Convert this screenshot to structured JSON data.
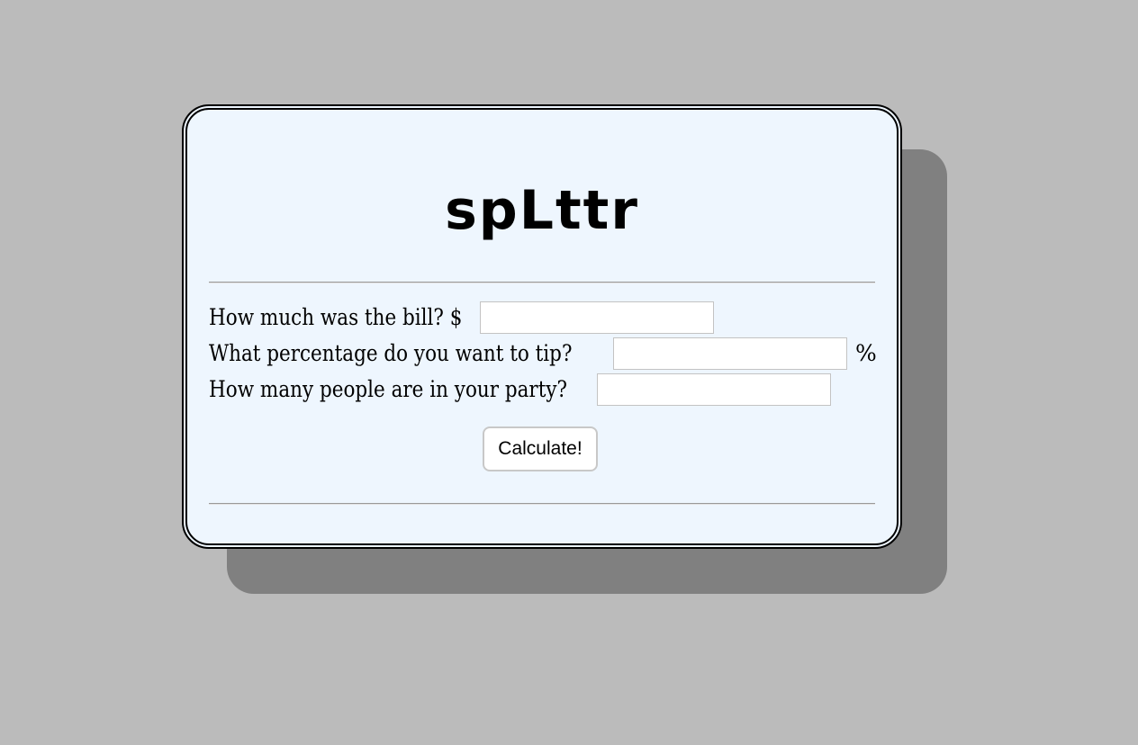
{
  "app": {
    "title": "spLttr"
  },
  "form": {
    "bill_label": "How much was the bill? $",
    "bill_value": "",
    "bill_placeholder": "",
    "tip_label": "What percentage do you want to tip?",
    "tip_value": "",
    "tip_placeholder": "",
    "tip_suffix": "%",
    "party_label": "How many people are in your party?",
    "party_value": "",
    "party_placeholder": ""
  },
  "actions": {
    "calculate_label": "Calculate!"
  },
  "colors": {
    "page_background": "#bbbbbb",
    "card_background": "#eef6fe",
    "card_shadow": "#808080",
    "card_border": "#000000",
    "text": "#000000"
  }
}
